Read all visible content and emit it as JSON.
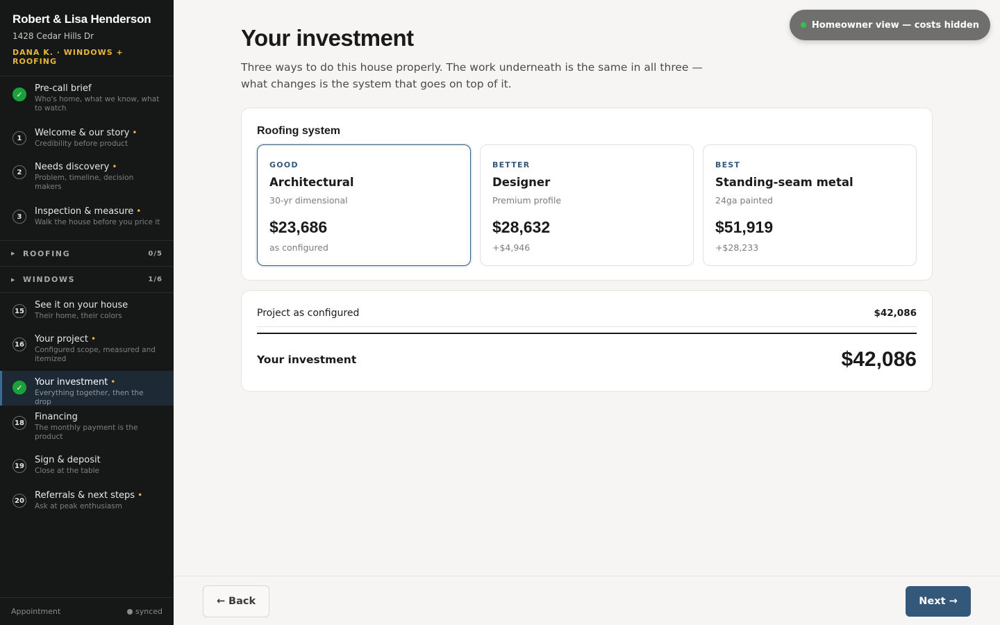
{
  "sidebar": {
    "client_name": "Robert & Lisa Henderson",
    "client_address": "1428 Cedar Hills Dr",
    "rep_line": "DANA K. · WINDOWS + ROOFING",
    "intro_steps": [
      {
        "num": "✓",
        "title": "Pre-call brief",
        "dot": "",
        "sub": "Who's home, what we know, what to watch",
        "state": "done"
      },
      {
        "num": "1",
        "title": "Welcome & our story",
        "dot": "•",
        "sub": "Credibility before product",
        "state": "todo"
      },
      {
        "num": "2",
        "title": "Needs discovery",
        "dot": "•",
        "sub": "Problem, timeline, decision makers",
        "state": "todo"
      },
      {
        "num": "3",
        "title": "Inspection & measure",
        "dot": "•",
        "sub": "Walk the house before you price it",
        "state": "todo"
      }
    ],
    "groups": [
      {
        "label": "ROOFING",
        "count": "0/5"
      },
      {
        "label": "WINDOWS",
        "count": "1/6"
      }
    ],
    "window_steps": [
      {
        "num": "15",
        "title": "See it on your house",
        "dot": "",
        "sub": "Their home, their colors",
        "state": "todo"
      },
      {
        "num": "16",
        "title": "Your project",
        "dot": "•",
        "sub": "Configured scope, measured and itemized",
        "state": "todo"
      },
      {
        "num": "✓",
        "title": "Your investment",
        "dot": "•",
        "sub": "Everything together, then the drop",
        "state": "active"
      },
      {
        "num": "18",
        "title": "Financing",
        "dot": "",
        "sub": "The monthly payment is the product",
        "state": "todo"
      },
      {
        "num": "19",
        "title": "Sign & deposit",
        "dot": "",
        "sub": "Close at the table",
        "state": "todo"
      },
      {
        "num": "20",
        "title": "Referrals & next steps",
        "dot": "•",
        "sub": "Ask at peak enthusiasm",
        "state": "todo"
      }
    ],
    "footer": {
      "left": "Appointment",
      "right": "synced"
    }
  },
  "pill": {
    "label": "Homeowner view — costs hidden"
  },
  "main": {
    "title": "Your investment",
    "subtitle": "Three ways to do this house properly. The work underneath is the same in all three — what changes is the system that goes on top of it.",
    "roof_card": {
      "title": "Roofing system",
      "tiers": [
        {
          "level": "GOOD",
          "name": "Architectural",
          "desc": "30-yr dimensional",
          "price": "$23,686",
          "delta": "as configured",
          "selected": true
        },
        {
          "level": "BETTER",
          "name": "Designer",
          "desc": "Premium profile",
          "price": "$28,632",
          "delta": "+$4,946",
          "selected": false
        },
        {
          "level": "BEST",
          "name": "Standing-seam metal",
          "desc": "24ga painted",
          "price": "$51,919",
          "delta": "+$28,233",
          "selected": false
        }
      ]
    },
    "total_card": {
      "line_label": "Project as configured",
      "line_amount": "$42,086",
      "investment_label": "Your investment",
      "investment_amount": "$42,086"
    }
  },
  "footer": {
    "back_label": "← Back",
    "next_label": "Next →"
  },
  "colors": {
    "accent": "#34587a",
    "success": "#1aa13c",
    "highlight": "#e8b83a",
    "sidebar_bg": "#161717"
  }
}
